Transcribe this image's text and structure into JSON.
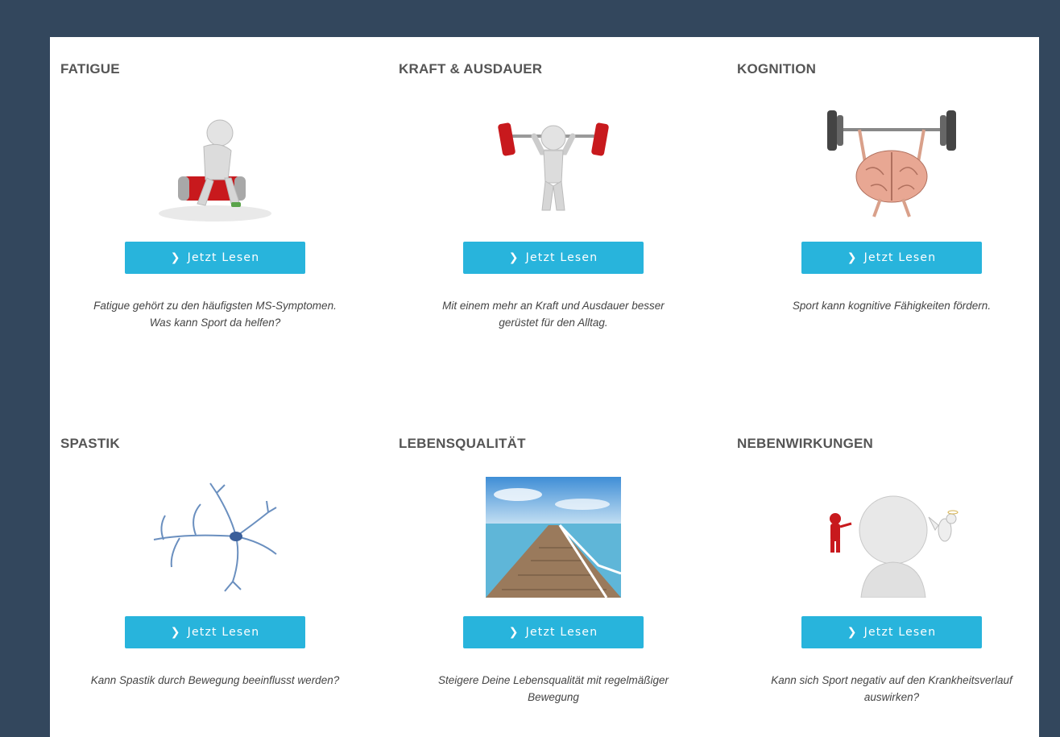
{
  "button_label": "Jetzt Lesen",
  "accent_color": "#28b4dc",
  "cards": [
    {
      "title": "FATIGUE",
      "image_icon": "figure-sitting-on-battery",
      "desc_line1": "Fatigue gehört zu den häufigsten MS-Symptomen.",
      "desc_line2": "Was kann Sport da helfen?"
    },
    {
      "title": "KRAFT & AUSDAUER",
      "image_icon": "figure-lifting-barbell",
      "desc_line1": "Mit einem mehr an Kraft und Ausdauer besser",
      "desc_line2": "gerüstet für den Alltag."
    },
    {
      "title": "KOGNITION",
      "image_icon": "brain-lifting-barbell",
      "desc_line1": "Sport kann kognitive Fähigkeiten fördern.",
      "desc_line2": ""
    },
    {
      "title": "SPASTIK",
      "image_icon": "neuron",
      "desc_line1": "Kann Spastik durch Bewegung beeinflusst werden?",
      "desc_line2": ""
    },
    {
      "title": "LEBENSQUALITÄT",
      "image_icon": "pier-to-sea",
      "desc_line1": "Steigere Deine Lebensqualität mit regelmäßiger",
      "desc_line2": "Bewegung"
    },
    {
      "title": "NEBENWIRKUNGEN",
      "image_icon": "figure-devil-angel",
      "desc_line1": "Kann sich Sport negativ auf den Krankheitsverlauf",
      "desc_line2": "auswirken?"
    }
  ]
}
